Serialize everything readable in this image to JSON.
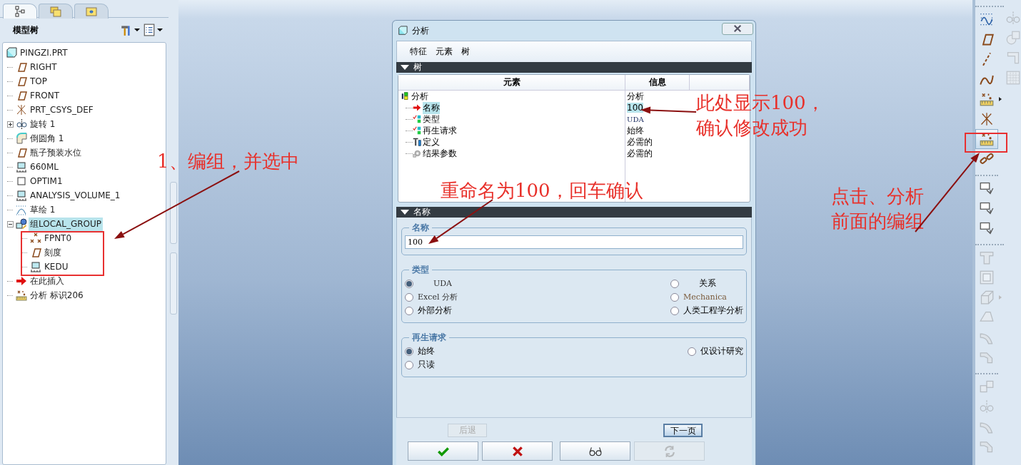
{
  "panel_tabs": [
    {
      "kind": "tree",
      "selected": true
    },
    {
      "kind": "folders",
      "selected": false
    },
    {
      "kind": "folder",
      "selected": false
    }
  ],
  "model_tree": {
    "title": "模型树",
    "items": [
      {
        "label": "PINGZI.PRT",
        "kind": "part",
        "selected": false,
        "children": [
          {
            "label": "RIGHT",
            "kind": "plane",
            "selected": false
          },
          {
            "label": "TOP",
            "kind": "plane",
            "selected": false
          },
          {
            "label": "FRONT",
            "kind": "plane",
            "selected": false
          },
          {
            "label": "PRT_CSYS_DEF",
            "kind": "csys",
            "selected": false
          },
          {
            "label": "旋转 1",
            "kind": "revolve",
            "selected": false,
            "expanded": false
          },
          {
            "label": "倒圆角 1",
            "kind": "round",
            "selected": false
          },
          {
            "label": "瓶子预装水位",
            "kind": "plane",
            "selected": false
          },
          {
            "label": "660ML",
            "kind": "analysis",
            "selected": false
          },
          {
            "label": "OPTIM1",
            "kind": "optim",
            "selected": false
          },
          {
            "label": "ANALYSIS_VOLUME_1",
            "kind": "analysis",
            "selected": false
          },
          {
            "label": "草绘 1",
            "kind": "sketch",
            "selected": false
          },
          {
            "label": "组LOCAL_GROUP",
            "kind": "group",
            "selected": true,
            "expanded": true,
            "children": [
              {
                "label": "FPNT0",
                "kind": "point",
                "selected": false
              },
              {
                "label": "刻度",
                "kind": "plane",
                "selected": false
              },
              {
                "label": "KEDU",
                "kind": "analysis",
                "selected": false
              }
            ]
          },
          {
            "label": "在此插入",
            "kind": "insert",
            "selected": false
          },
          {
            "label": "分析 标识206",
            "kind": "analysis-feature",
            "selected": false
          }
        ]
      }
    ]
  },
  "dialog": {
    "title": "分析",
    "menu": [
      "特征",
      "元素",
      "树"
    ],
    "tree_section": {
      "title": "树",
      "expanded": true,
      "columns": [
        "元素",
        "信息"
      ],
      "root": {
        "element": "分析",
        "info": "分析",
        "kind": "root"
      },
      "rows": [
        {
          "element": "名称",
          "info": "100",
          "kind": "arrow",
          "selected": true
        },
        {
          "element": "类型",
          "info": "UDA",
          "kind": "check",
          "selected": false
        },
        {
          "element": "再生请求",
          "info": "始终",
          "kind": "check",
          "selected": false
        },
        {
          "element": "定义",
          "info": "必需的",
          "kind": "define",
          "selected": false
        },
        {
          "element": "结果参数",
          "info": "必需的",
          "kind": "params",
          "selected": false
        }
      ]
    },
    "name_section": {
      "title": "名称",
      "expanded": true,
      "group_label": "名称",
      "value": "100"
    },
    "type_group": {
      "label": "类型",
      "options": [
        {
          "label": "UDA",
          "selected": true
        },
        {
          "label": "Excel 分析",
          "selected": false
        },
        {
          "label": "外部分析",
          "selected": false
        },
        {
          "label": "关系",
          "selected": false
        },
        {
          "label": "Mechanica",
          "selected": false
        },
        {
          "label": "人类工程学分析",
          "selected": false
        }
      ]
    },
    "regen_group": {
      "label": "再生请求",
      "options": [
        {
          "label": "始终",
          "selected": true
        },
        {
          "label": "只读",
          "selected": false
        },
        {
          "label": "仅设计研究",
          "selected": false
        }
      ]
    },
    "nav_buttons": [
      {
        "label": "后退",
        "disabled": true
      },
      {
        "label": "下一页",
        "disabled": false
      }
    ],
    "action_buttons": [
      {
        "kind": "ok",
        "disabled": false
      },
      {
        "kind": "cancel",
        "disabled": false
      },
      {
        "kind": "preview",
        "disabled": false
      },
      {
        "kind": "regenerate",
        "disabled": true
      }
    ]
  },
  "toolbar": {
    "groups": [
      {
        "items": [
          {
            "kind": "datum-curve",
            "disabled": false,
            "pressed": false
          },
          {
            "kind": "plane",
            "disabled": false,
            "pressed": false
          },
          {
            "kind": "axis",
            "disabled": false,
            "pressed": false
          },
          {
            "kind": "curve",
            "disabled": false,
            "pressed": false
          },
          {
            "kind": "analysis-feature",
            "disabled": false,
            "pressed": false,
            "flyout": true
          },
          {
            "kind": "csys",
            "disabled": false,
            "pressed": false
          },
          {
            "kind": "analysis-feature",
            "disabled": false,
            "pressed": true
          },
          {
            "kind": "chain",
            "disabled": false,
            "pressed": false
          }
        ]
      },
      {
        "items": [
          {
            "kind": "copy",
            "disabled": false,
            "pressed": false
          },
          {
            "kind": "copy",
            "disabled": false,
            "pressed": false
          },
          {
            "kind": "copy",
            "disabled": false,
            "pressed": false
          }
        ]
      },
      {
        "items": [
          {
            "kind": "slot",
            "disabled": true,
            "pressed": false
          },
          {
            "kind": "frame",
            "disabled": true,
            "pressed": false
          },
          {
            "kind": "block",
            "disabled": true,
            "pressed": false,
            "flyout": true
          },
          {
            "kind": "wedge",
            "disabled": true,
            "pressed": false
          },
          {
            "kind": "bend",
            "disabled": true,
            "pressed": false
          },
          {
            "kind": "bevel",
            "disabled": true,
            "pressed": false
          }
        ]
      },
      {
        "items": [
          {
            "kind": "cubes",
            "disabled": true,
            "pressed": false
          },
          {
            "kind": "mirror",
            "disabled": true,
            "pressed": false
          },
          {
            "kind": "bend",
            "disabled": true,
            "pressed": false
          },
          {
            "kind": "bevel",
            "disabled": true,
            "pressed": false
          }
        ]
      }
    ],
    "side_items": [
      {
        "kind": "mirror",
        "disabled": true
      },
      {
        "kind": "shapes",
        "disabled": true
      },
      {
        "kind": "corner",
        "disabled": true
      },
      {
        "kind": "grid",
        "disabled": true
      }
    ]
  },
  "annotations": [
    {
      "text": "1、编组，并选中"
    },
    {
      "text": "此处显示100，"
    },
    {
      "text": "确认修改成功"
    },
    {
      "text": "重命名为100，回车确认"
    },
    {
      "text": "点击、分析"
    },
    {
      "text": "前面的编组"
    }
  ]
}
